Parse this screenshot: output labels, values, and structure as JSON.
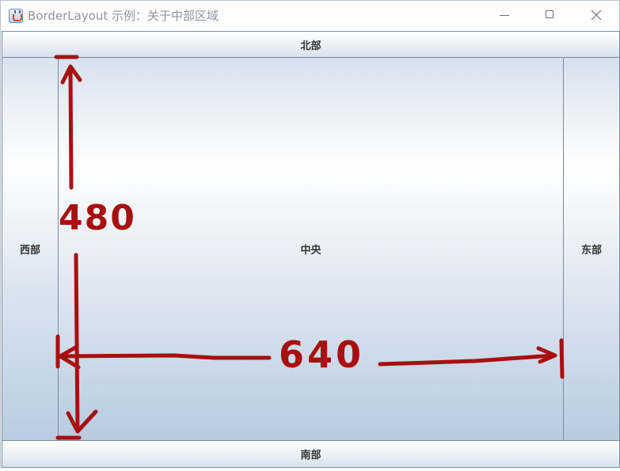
{
  "window": {
    "title": "BorderLayout 示例：关于中部区域",
    "icon": "java-cup-icon",
    "controls": [
      "minimize-icon",
      "maximize-icon",
      "close-icon"
    ]
  },
  "regions": {
    "north": "北部",
    "west": "西部",
    "center": "中央",
    "east": "东部",
    "south": "南部"
  },
  "annotations": {
    "height_label": "480",
    "width_label": "640",
    "color": "#a81010"
  }
}
